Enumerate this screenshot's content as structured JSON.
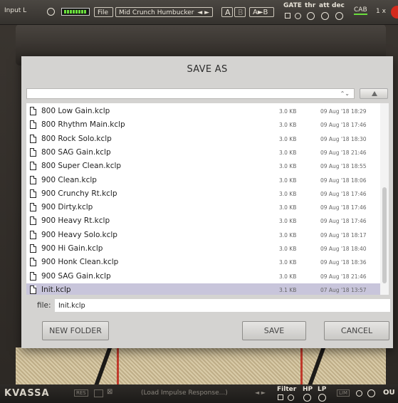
{
  "topbar": {
    "input_label": "Input L",
    "file_label": "File",
    "preset_name": "Mid Crunch Humbucker",
    "preset_arrows": "◄ ►",
    "slot_a": "A",
    "slot_b": "B",
    "copy_ab": "A►B",
    "gate_label": "GATE",
    "thr_label": "thr",
    "att_label": "att",
    "dec_label": "dec",
    "cab_label": "CAB",
    "oversample": "1 x"
  },
  "bottombar": {
    "logo": "KVASSA",
    "res_label": "RES",
    "load_ir": "(Load Impulse Response...)",
    "filter_label": "Filter",
    "hp_label": "HP",
    "lp_label": "LP",
    "lim_label": "LIM",
    "out_label": "OU"
  },
  "dialog": {
    "title": "SAVE AS",
    "path_value": "",
    "path_stepper": "⌃⌄",
    "files": [
      {
        "name": "800 Low Gain.kclp",
        "size": "3.0 KB",
        "date": "09 Aug '18 18:29"
      },
      {
        "name": "800 Rhythm Main.kclp",
        "size": "3.0 KB",
        "date": "09 Aug '18 17:46"
      },
      {
        "name": "800 Rock Solo.kclp",
        "size": "3.0 KB",
        "date": "09 Aug '18 18:30"
      },
      {
        "name": "800 SAG Gain.kclp",
        "size": "3.0 KB",
        "date": "09 Aug '18 21:46"
      },
      {
        "name": "800 Super Clean.kclp",
        "size": "3.0 KB",
        "date": "09 Aug '18 18:55"
      },
      {
        "name": "900 Clean.kclp",
        "size": "3.0 KB",
        "date": "09 Aug '18 18:06"
      },
      {
        "name": "900 Crunchy Rt.kclp",
        "size": "3.0 KB",
        "date": "09 Aug '18 17:46"
      },
      {
        "name": "900 Dirty.kclp",
        "size": "3.0 KB",
        "date": "09 Aug '18 17:46"
      },
      {
        "name": "900 Heavy Rt.kclp",
        "size": "3.0 KB",
        "date": "09 Aug '18 17:46"
      },
      {
        "name": "900 Heavy Solo.kclp",
        "size": "3.0 KB",
        "date": "09 Aug '18 18:17"
      },
      {
        "name": "900 Hi Gain.kclp",
        "size": "3.0 KB",
        "date": "09 Aug '18 18:40"
      },
      {
        "name": "900 Honk Clean.kclp",
        "size": "3.0 KB",
        "date": "09 Aug '18 18:36"
      },
      {
        "name": "900 SAG Gain.kclp",
        "size": "3.0 KB",
        "date": "09 Aug '18 21:46"
      },
      {
        "name": "Init.kclp",
        "size": "3.1 KB",
        "date": "07 Aug '18 13:57",
        "selected": true
      }
    ],
    "file_label": "file:",
    "file_value": "Init.kclp",
    "new_folder_label": "NEW FOLDER",
    "save_label": "SAVE",
    "cancel_label": "CANCEL"
  },
  "colors": {
    "selection": "#c8c5db",
    "dialog_bg": "#d4d3d1",
    "meter_green": "#6adf3c",
    "accent_red": "#d42a1c"
  }
}
